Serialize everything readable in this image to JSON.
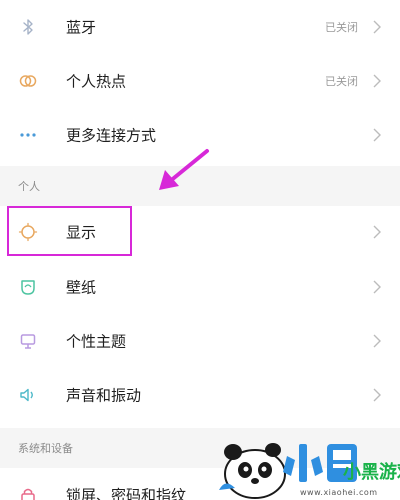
{
  "settings": {
    "rows_top": [
      {
        "label": "蓝牙",
        "status": "已关闭",
        "icon": "bluetooth-icon"
      },
      {
        "label": "个人热点",
        "status": "已关闭",
        "icon": "hotspot-icon"
      },
      {
        "label": "更多连接方式",
        "status": "",
        "icon": "more-dots-icon"
      }
    ],
    "section_personal": "个人",
    "rows_personal": [
      {
        "label": "显示",
        "icon": "display-icon"
      },
      {
        "label": "壁纸",
        "icon": "wallpaper-icon"
      },
      {
        "label": "个性主题",
        "icon": "theme-icon"
      },
      {
        "label": "声音和振动",
        "icon": "sound-icon"
      }
    ],
    "section_system": "系统和设备",
    "rows_system": [
      {
        "label": "锁屏、密码和指纹",
        "icon": "lock-icon"
      }
    ]
  },
  "annotation": {
    "highlight_color": "#d728d8",
    "arrow_color": "#d728d8"
  },
  "watermark": {
    "text": "小黑游戏",
    "url": "www.xiaohei.com",
    "colors": {
      "primary": "#2f8fe0",
      "secondary": "#1ab24a"
    }
  },
  "colors": {
    "label": "#1f1f1f",
    "status": "#9a9a9a",
    "section_bg": "#f5f5f5",
    "section_text": "#8c8c8c",
    "icon_blue": "#7fa6d8",
    "icon_orange": "#e8a860",
    "icon_green": "#4cc4a0",
    "icon_purple": "#b89ae0",
    "icon_cyan": "#4cb8c8"
  }
}
